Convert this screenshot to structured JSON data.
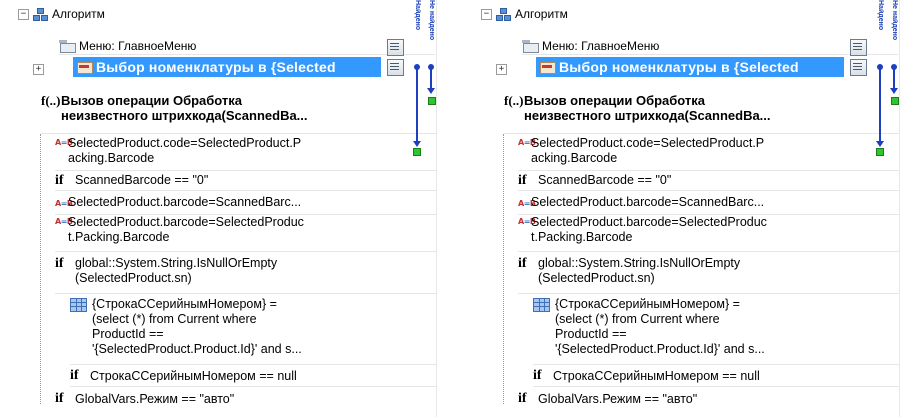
{
  "root": {
    "expander": "−",
    "label": "Алгоритм"
  },
  "menu": {
    "label": "Меню: ГлавноеМеню"
  },
  "selection": {
    "expander": "+",
    "label": "Выбор номенклатуры в {Selected"
  },
  "operation": {
    "label_line1": "Вызов операции Обработка",
    "label_line2": "неизвестного штрихкода(ScannedBa..."
  },
  "rows": [
    {
      "type": "assign",
      "line1": "SelectedProduct.code=SelectedProduct.P",
      "line2": "acking.Barcode"
    },
    {
      "type": "if",
      "line1": "ScannedBarcode == \"0\"",
      "line2": ""
    },
    {
      "type": "assign",
      "line1": "SelectedProduct.barcode=ScannedBarc...",
      "line2": ""
    },
    {
      "type": "assign",
      "line1": "SelectedProduct.barcode=SelectedProduc",
      "line2": "t.Packing.Barcode"
    },
    {
      "type": "if",
      "line1": "global::System.String.IsNullOrEmpty",
      "line2": "(SelectedProduct.sn)"
    },
    {
      "type": "query",
      "line1": "{СтрокаССерийнымНомером} =",
      "line2": "(select (*) from Current where",
      "line3": "ProductId ==",
      "line4": "'{SelectedProduct.Product.Id}' and s..."
    },
    {
      "type": "if-nested",
      "line1": "СтрокаССерийнымНомером == null",
      "line2": ""
    },
    {
      "type": "if",
      "line1": "GlobalVars.Режим == \"авто\"",
      "line2": ""
    }
  ],
  "columns": {
    "col1": "Найдено",
    "col2": "Не найдено"
  },
  "icons": {
    "keyword_fx": "f(..)",
    "keyword_if": "if",
    "assign_icon": "A=B"
  },
  "colors": {
    "selection": "#3399ff",
    "flow_line": "#1e3fc0",
    "flow_end": "#2ec52e"
  }
}
